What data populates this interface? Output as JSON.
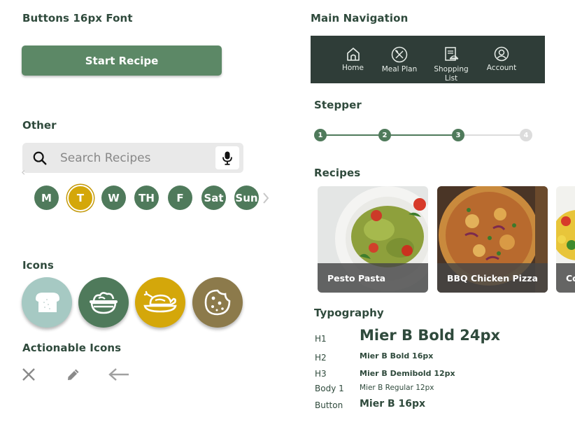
{
  "buttons": {
    "heading": "Buttons 16px Font",
    "start_label": "Start Recipe"
  },
  "other": {
    "heading": "Other",
    "search_placeholder": "Search Recipes",
    "days": [
      "M",
      "T",
      "W",
      "TH",
      "F",
      "Sat",
      "Sun"
    ],
    "active_day": "T"
  },
  "icons": {
    "heading": "Icons",
    "items": [
      {
        "name": "bread-icon",
        "color": "#a6c9c3"
      },
      {
        "name": "salad-bowl-icon",
        "color": "#4f7a5b"
      },
      {
        "name": "roast-chicken-icon",
        "color": "#d4a70a"
      },
      {
        "name": "cookie-icon",
        "color": "#8c7a4b"
      }
    ]
  },
  "actionable": {
    "heading": "Actionable Icons",
    "items": [
      "close-icon",
      "pencil-icon",
      "arrow-left-icon"
    ]
  },
  "nav": {
    "heading": "Main Navigation",
    "items": [
      {
        "label": "Home",
        "icon": "home-icon"
      },
      {
        "label": "Meal Plan",
        "icon": "utensils-icon"
      },
      {
        "label": "Shopping List",
        "icon": "shopping-list-icon"
      },
      {
        "label": "Account",
        "icon": "account-icon"
      }
    ]
  },
  "stepper": {
    "heading": "Stepper",
    "steps": [
      "1",
      "2",
      "3",
      "4"
    ],
    "current": 3
  },
  "recipes": {
    "heading": "Recipes",
    "items": [
      "Pesto Pasta",
      "BBQ Chicken Pizza",
      "Co"
    ]
  },
  "typography": {
    "heading": "Typography",
    "rows": [
      {
        "label": "H1",
        "sample": "Mier B Bold 24px"
      },
      {
        "label": "H2",
        "sample": "Mier B Bold 16px"
      },
      {
        "label": "H3",
        "sample": "Mier B Demibold 12px"
      },
      {
        "label": "Body 1",
        "sample": "Mier B Regular 12px"
      },
      {
        "label": "Button",
        "sample": "Mier B 16px"
      }
    ]
  },
  "colors": {
    "primary": "#5c8866",
    "dark": "#2f3d38",
    "accent": "#d4a70a",
    "text": "#2f4a3c"
  }
}
